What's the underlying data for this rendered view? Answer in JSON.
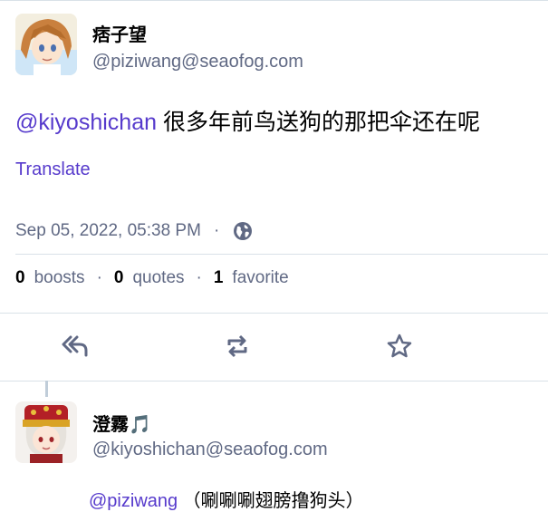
{
  "status": {
    "display_name": "痞子望",
    "acct": "@piziwang@seaofog.com",
    "mention": "@kiyoshichan",
    "text": " 很多年前鸟送狗的那把伞还在呢",
    "translate_label": "Translate",
    "timestamp": "Sep 05, 2022, 05:38 PM",
    "meta_separator": "·",
    "visibility_icon": "globe-icon"
  },
  "stats": {
    "boosts_count": "0",
    "boosts_label": "boosts",
    "quotes_count": "0",
    "quotes_label": "quotes",
    "favorites_count": "1",
    "favorites_label": "favorite",
    "separator": "·"
  },
  "actions": {
    "reply_icon": "reply-all-icon",
    "boost_icon": "boost-icon",
    "favorite_icon": "star-icon"
  },
  "reply": {
    "display_name": "澄霧🎵",
    "acct": "@kiyoshichan@seaofog.com",
    "mention": "@piziwang",
    "text": " （唰唰唰翅膀撸狗头）"
  },
  "colors": {
    "accent": "#563acc",
    "muted": "#606984",
    "border": "#d9e1e8"
  }
}
